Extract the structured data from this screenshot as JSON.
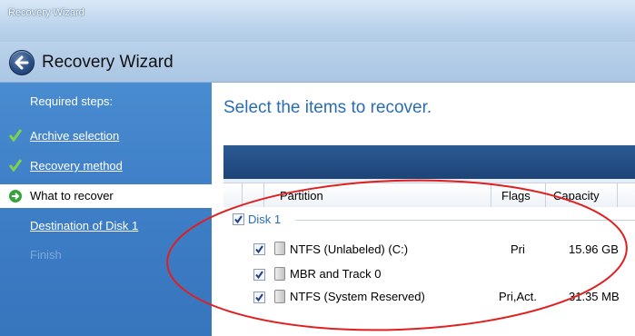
{
  "window": {
    "title": "Recovery Wizard"
  },
  "header": {
    "title": "Recovery Wizard"
  },
  "sidebar": {
    "heading": "Required steps:",
    "items": [
      {
        "label": "Archive selection",
        "state": "done"
      },
      {
        "label": "Recovery method",
        "state": "done"
      },
      {
        "label": "What to recover",
        "state": "current"
      },
      {
        "label": "Destination of Disk 1",
        "state": "pending"
      },
      {
        "label": "Finish",
        "state": "disabled"
      }
    ]
  },
  "main": {
    "title": "Select the items to recover.",
    "columns": [
      "Partition",
      "Flags",
      "Capacity"
    ],
    "disk": {
      "label": "Disk 1",
      "checked": true
    },
    "rows": [
      {
        "partition": "NTFS (Unlabeled) (C:)",
        "flags": "Pri",
        "capacity": "15.96 GB",
        "checked": true
      },
      {
        "partition": "MBR and Track 0",
        "flags": "",
        "capacity": "",
        "checked": true
      },
      {
        "partition": "NTFS (System Reserved)",
        "flags": "Pri,Act.",
        "capacity": "31.35 MB",
        "checked": true
      }
    ]
  },
  "colors": {
    "sidebar": "#3f80c8",
    "title_accent": "#2a6db5",
    "annotation": "#e02020",
    "check_green": "#38a33e"
  }
}
